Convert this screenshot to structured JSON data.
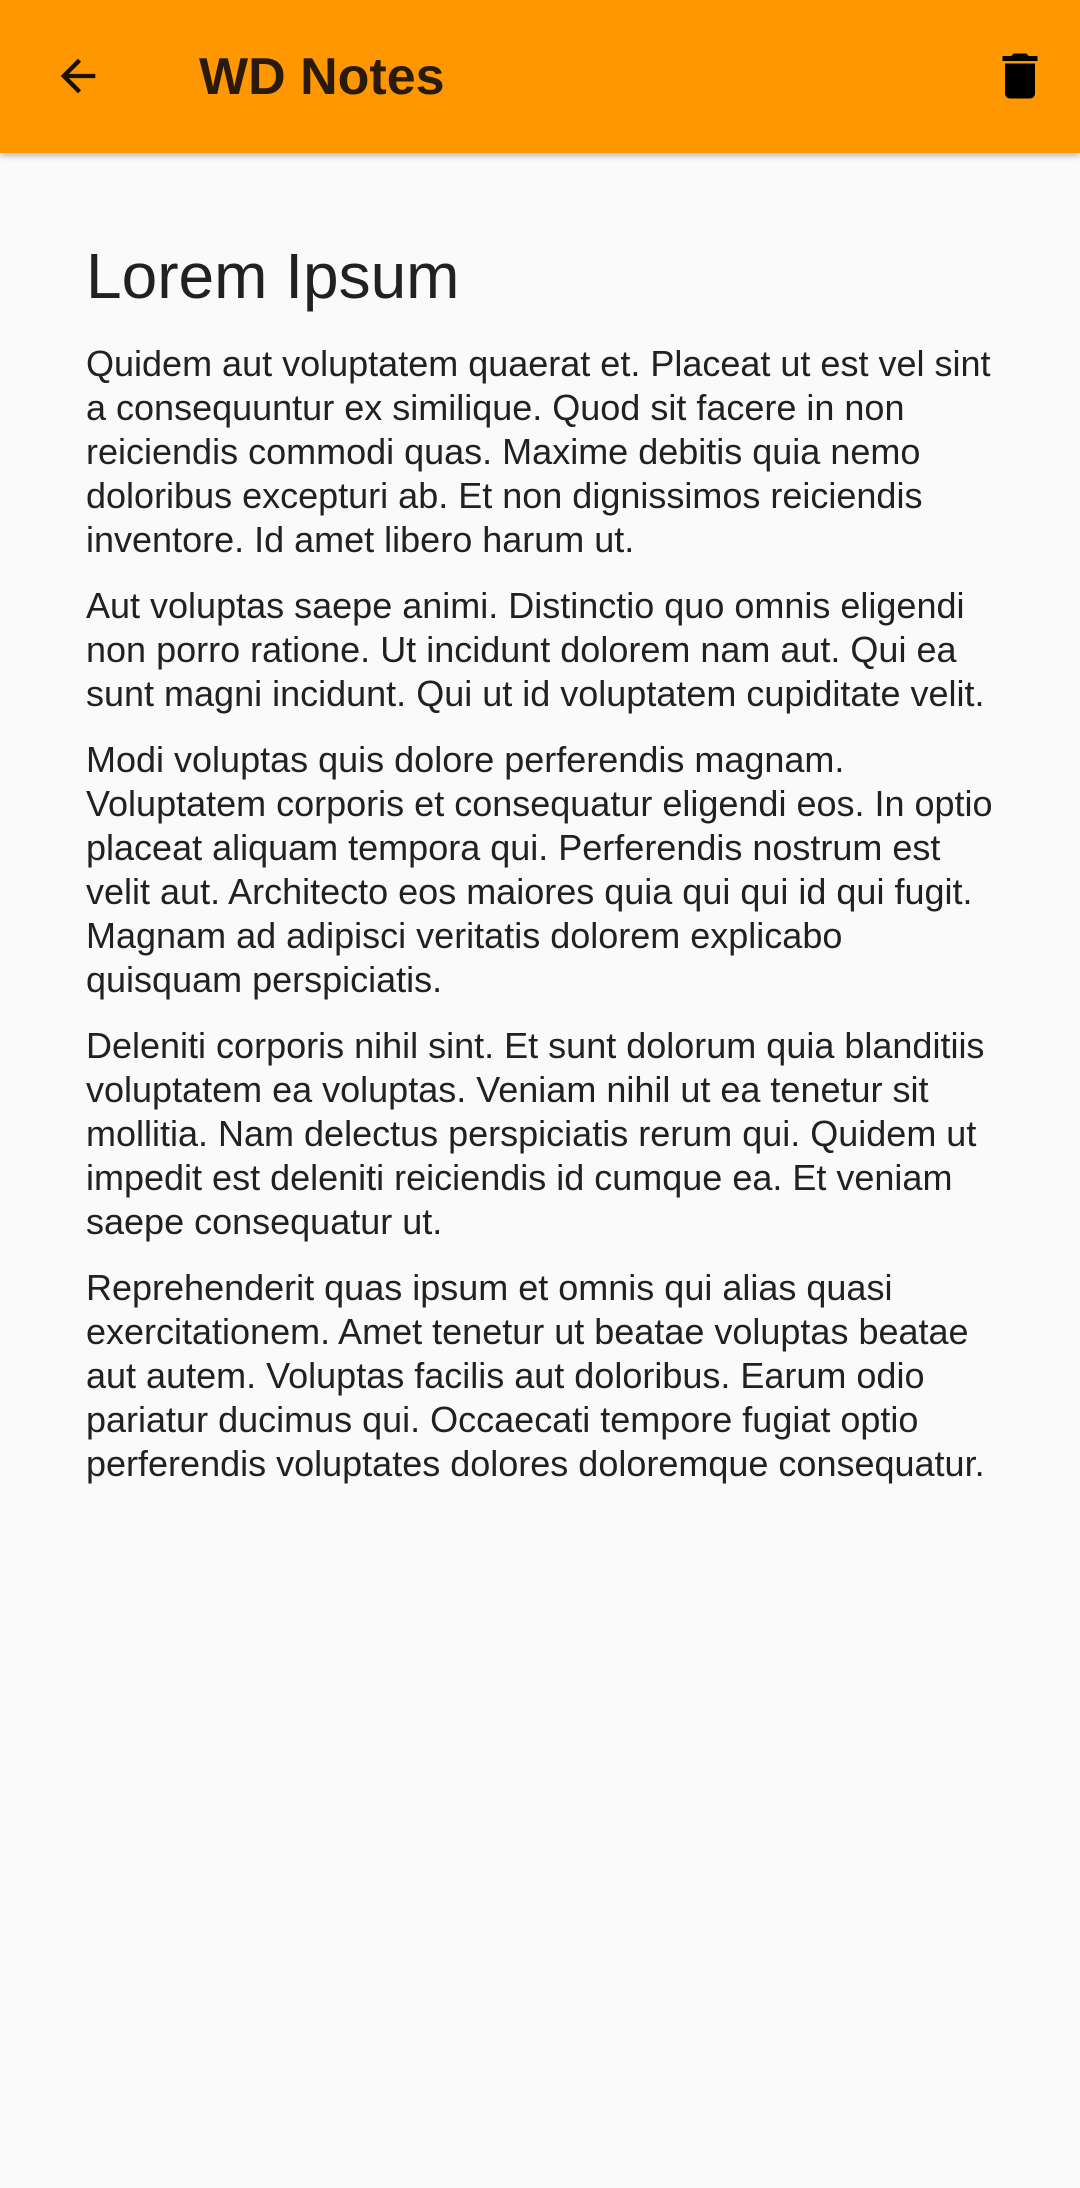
{
  "app_bar": {
    "title": "WD Notes",
    "back_icon": "arrow-back-icon",
    "delete_icon": "trash-icon",
    "background_color": "#ff9800"
  },
  "note": {
    "title": "Lorem Ipsum",
    "paragraphs": [
      "Quidem aut voluptatem quaerat et. Placeat ut est vel sint a consequuntur ex similique. Quod sit facere in non reiciendis commodi quas. Maxime debitis quia nemo doloribus excepturi ab. Et non dignissimos reiciendis inventore. Id amet libero harum ut.",
      "Aut voluptas saepe animi. Distinctio quo omnis eligendi non porro ratione. Ut incidunt dolorem nam aut. Qui ea sunt magni incidunt. Qui ut id voluptatem cupiditate velit.",
      "Modi voluptas quis dolore perferendis magnam. Voluptatem corporis et consequatur eligendi eos. In optio placeat aliquam tempora qui. Perferendis nostrum est velit aut. Architecto eos maiores quia qui qui id qui fugit. Magnam ad adipisci veritatis dolorem explicabo quisquam perspiciatis.",
      "Deleniti corporis nihil sint. Et sunt dolorum quia blanditiis voluptatem ea voluptas. Veniam nihil ut ea tenetur sit mollitia. Nam delectus perspiciatis rerum qui. Quidem ut impedit est deleniti reiciendis id cumque ea. Et veniam saepe consequatur ut.",
      "Reprehenderit quas ipsum et omnis qui alias quasi exercitationem. Amet tenetur ut beatae voluptas beatae aut autem. Voluptas facilis aut doloribus. Earum odio pariatur ducimus qui. Occaecati tempore fugiat optio perferendis voluptates dolores doloremque consequatur."
    ]
  }
}
